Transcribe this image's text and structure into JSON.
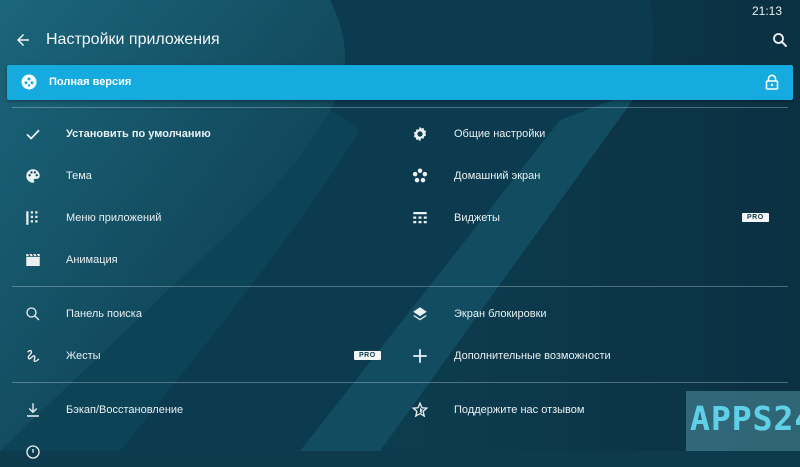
{
  "status_bar": {
    "time": "21:13"
  },
  "app_bar": {
    "title": "Настройки приложения"
  },
  "banner": {
    "label": "Полная версия",
    "color": "#16abde"
  },
  "badge": {
    "pro": "PRO"
  },
  "left_items": [
    {
      "label": "Установить по умолчанию",
      "icon": "check-icon"
    },
    {
      "label": "Тема",
      "icon": "palette-icon"
    },
    {
      "label": "Меню приложений",
      "icon": "apps-grid-icon"
    },
    {
      "label": "Анимация",
      "icon": "clapperboard-icon"
    },
    {
      "label": "Панель поиска",
      "icon": "search-icon"
    },
    {
      "label": "Жесты",
      "icon": "gesture-icon"
    },
    {
      "label": "Бэкап/Восстановление",
      "icon": "download-icon"
    }
  ],
  "right_items": [
    {
      "label": "Общие настройки",
      "icon": "gear-icon"
    },
    {
      "label": "Домашний экран",
      "icon": "flower-icon"
    },
    {
      "label": "Виджеты",
      "icon": "widgets-icon"
    },
    {
      "label": "Экран блокировки",
      "icon": "layers-icon"
    },
    {
      "label": "Дополнительные возможности",
      "icon": "plus-icon"
    },
    {
      "label": "Поддержите нас отзывом",
      "icon": "star-icon"
    }
  ],
  "watermark": {
    "text": "APPS24"
  }
}
